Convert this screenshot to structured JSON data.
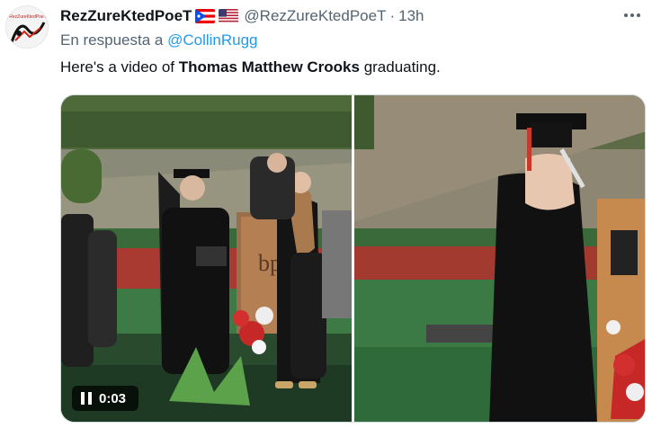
{
  "tweet": {
    "author": {
      "display_name": "RezZureKtedPoeT",
      "handle": "@RezZureKtedPoeT",
      "flags": [
        "puerto-rico-flag",
        "us-flag"
      ]
    },
    "time_separator": "·",
    "timestamp": "13h",
    "reply": {
      "prefix": "En respuesta a",
      "mention": "@CollinRugg"
    },
    "text": {
      "before": "Here's a video of ",
      "bold": "Thomas Matthew Crooks",
      "after": " graduating."
    },
    "media": {
      "duration": "0:03",
      "control_icon": "pause-icon"
    }
  },
  "colors": {
    "link": "#1d9bf0",
    "secondary_text": "#536471",
    "primary_text": "#0f1419"
  }
}
